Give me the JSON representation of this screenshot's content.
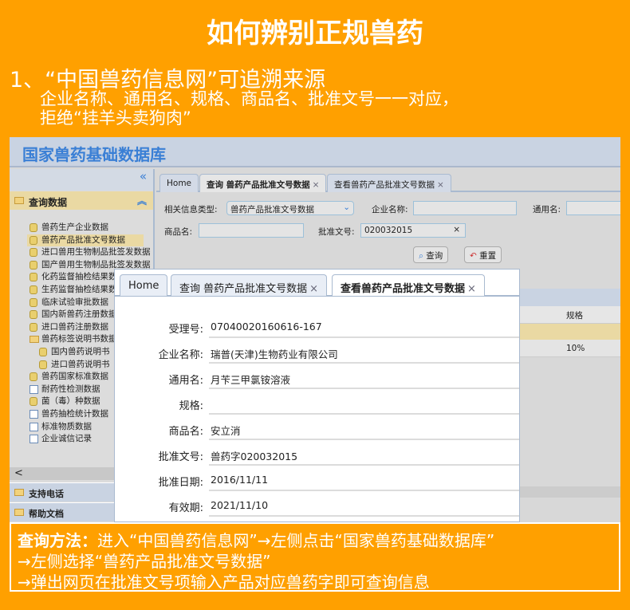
{
  "title": "如何辨别正规兽药",
  "intro": {
    "line1": "1、“中国兽药信息网”可追溯来源",
    "line2": "企业名称、通用名、规格、商品名、批准文号一一对应，",
    "line3": "拒绝“挂羊头卖狗肉”"
  },
  "app": {
    "header_title": "国家兽药基础数据库",
    "sidebar": {
      "collapse": "«",
      "section": "查询数据",
      "items": [
        {
          "label": "兽药生产企业数据",
          "icon": "db"
        },
        {
          "label": "兽药产品批准文号数据",
          "icon": "db",
          "selected": true
        },
        {
          "label": "进口兽用生物制品批签发数据",
          "icon": "db"
        },
        {
          "label": "国产兽用生物制品批签发数据",
          "icon": "db"
        },
        {
          "label": "化药监督抽检结果数据",
          "icon": "db"
        },
        {
          "label": "生药监督抽检结果数据",
          "icon": "db"
        },
        {
          "label": "临床试验审批数据",
          "icon": "db"
        },
        {
          "label": "国内新兽药注册数据",
          "icon": "db"
        },
        {
          "label": "进口兽药注册数据",
          "icon": "db"
        },
        {
          "label": "兽药标签说明书数据",
          "icon": "folder"
        },
        {
          "label": "国内兽药说明书",
          "icon": "db",
          "child": true
        },
        {
          "label": "进口兽药说明书",
          "icon": "db",
          "child": true
        },
        {
          "label": "兽药国家标准数据",
          "icon": "db"
        },
        {
          "label": "耐药性检测数据",
          "icon": "page"
        },
        {
          "label": "菌（毒）种数据",
          "icon": "db"
        },
        {
          "label": "兽药抽检统计数据",
          "icon": "page"
        },
        {
          "label": "标准物质数据",
          "icon": "page"
        },
        {
          "label": "企业诚信记录",
          "icon": "page"
        }
      ],
      "scroll_left": "<",
      "support": "支持电话",
      "help": "帮助文档"
    },
    "tabs": [
      "Home",
      "查询 兽药产品批准文号数据",
      "查看兽药产品批准文号数据"
    ],
    "tab_close": "×",
    "form": {
      "type_label": "相关信息类型:",
      "type_value": "兽药产品批准文号数据",
      "company_label": "企业名称:",
      "company_value": "",
      "generic_label": "通用名:",
      "generic_value": "",
      "trade_label": "商品名:",
      "trade_value": "",
      "approval_label": "批准文号:",
      "approval_value": "020032015",
      "clear": "×",
      "query": "查询",
      "reset": "重置"
    },
    "grid": {
      "col_spec": "规格",
      "rows": [
        {
          "spec": ""
        },
        {
          "spec": "10%"
        }
      ]
    }
  },
  "popup": {
    "tabs": [
      "Home",
      "查询 兽药产品批准文号数据",
      "查看兽药产品批准文号数据"
    ],
    "fields": [
      {
        "label": "受理号:",
        "value": "07040020160616-167"
      },
      {
        "label": "企业名称:",
        "value": "瑞普(天津)生物药业有限公司"
      },
      {
        "label": "通用名:",
        "value": "月苄三甲氯铵溶液"
      },
      {
        "label": "规格:",
        "value": ""
      },
      {
        "label": "商品名:",
        "value": "安立消"
      },
      {
        "label": "批准文号:",
        "value": "兽药字020032015"
      },
      {
        "label": "批准日期:",
        "value": "2016/11/11"
      },
      {
        "label": "有效期:",
        "value": "2021/11/10"
      }
    ]
  },
  "method": {
    "label": "查询方法：",
    "line1": "进入“中国兽药信息网”→左侧点击“国家兽药基础数据库”",
    "line2": "→左侧选择“兽药产品批准文号数据”",
    "line3": "→弹出网页在批准文号项输入产品对应兽药字即可查询信息"
  }
}
